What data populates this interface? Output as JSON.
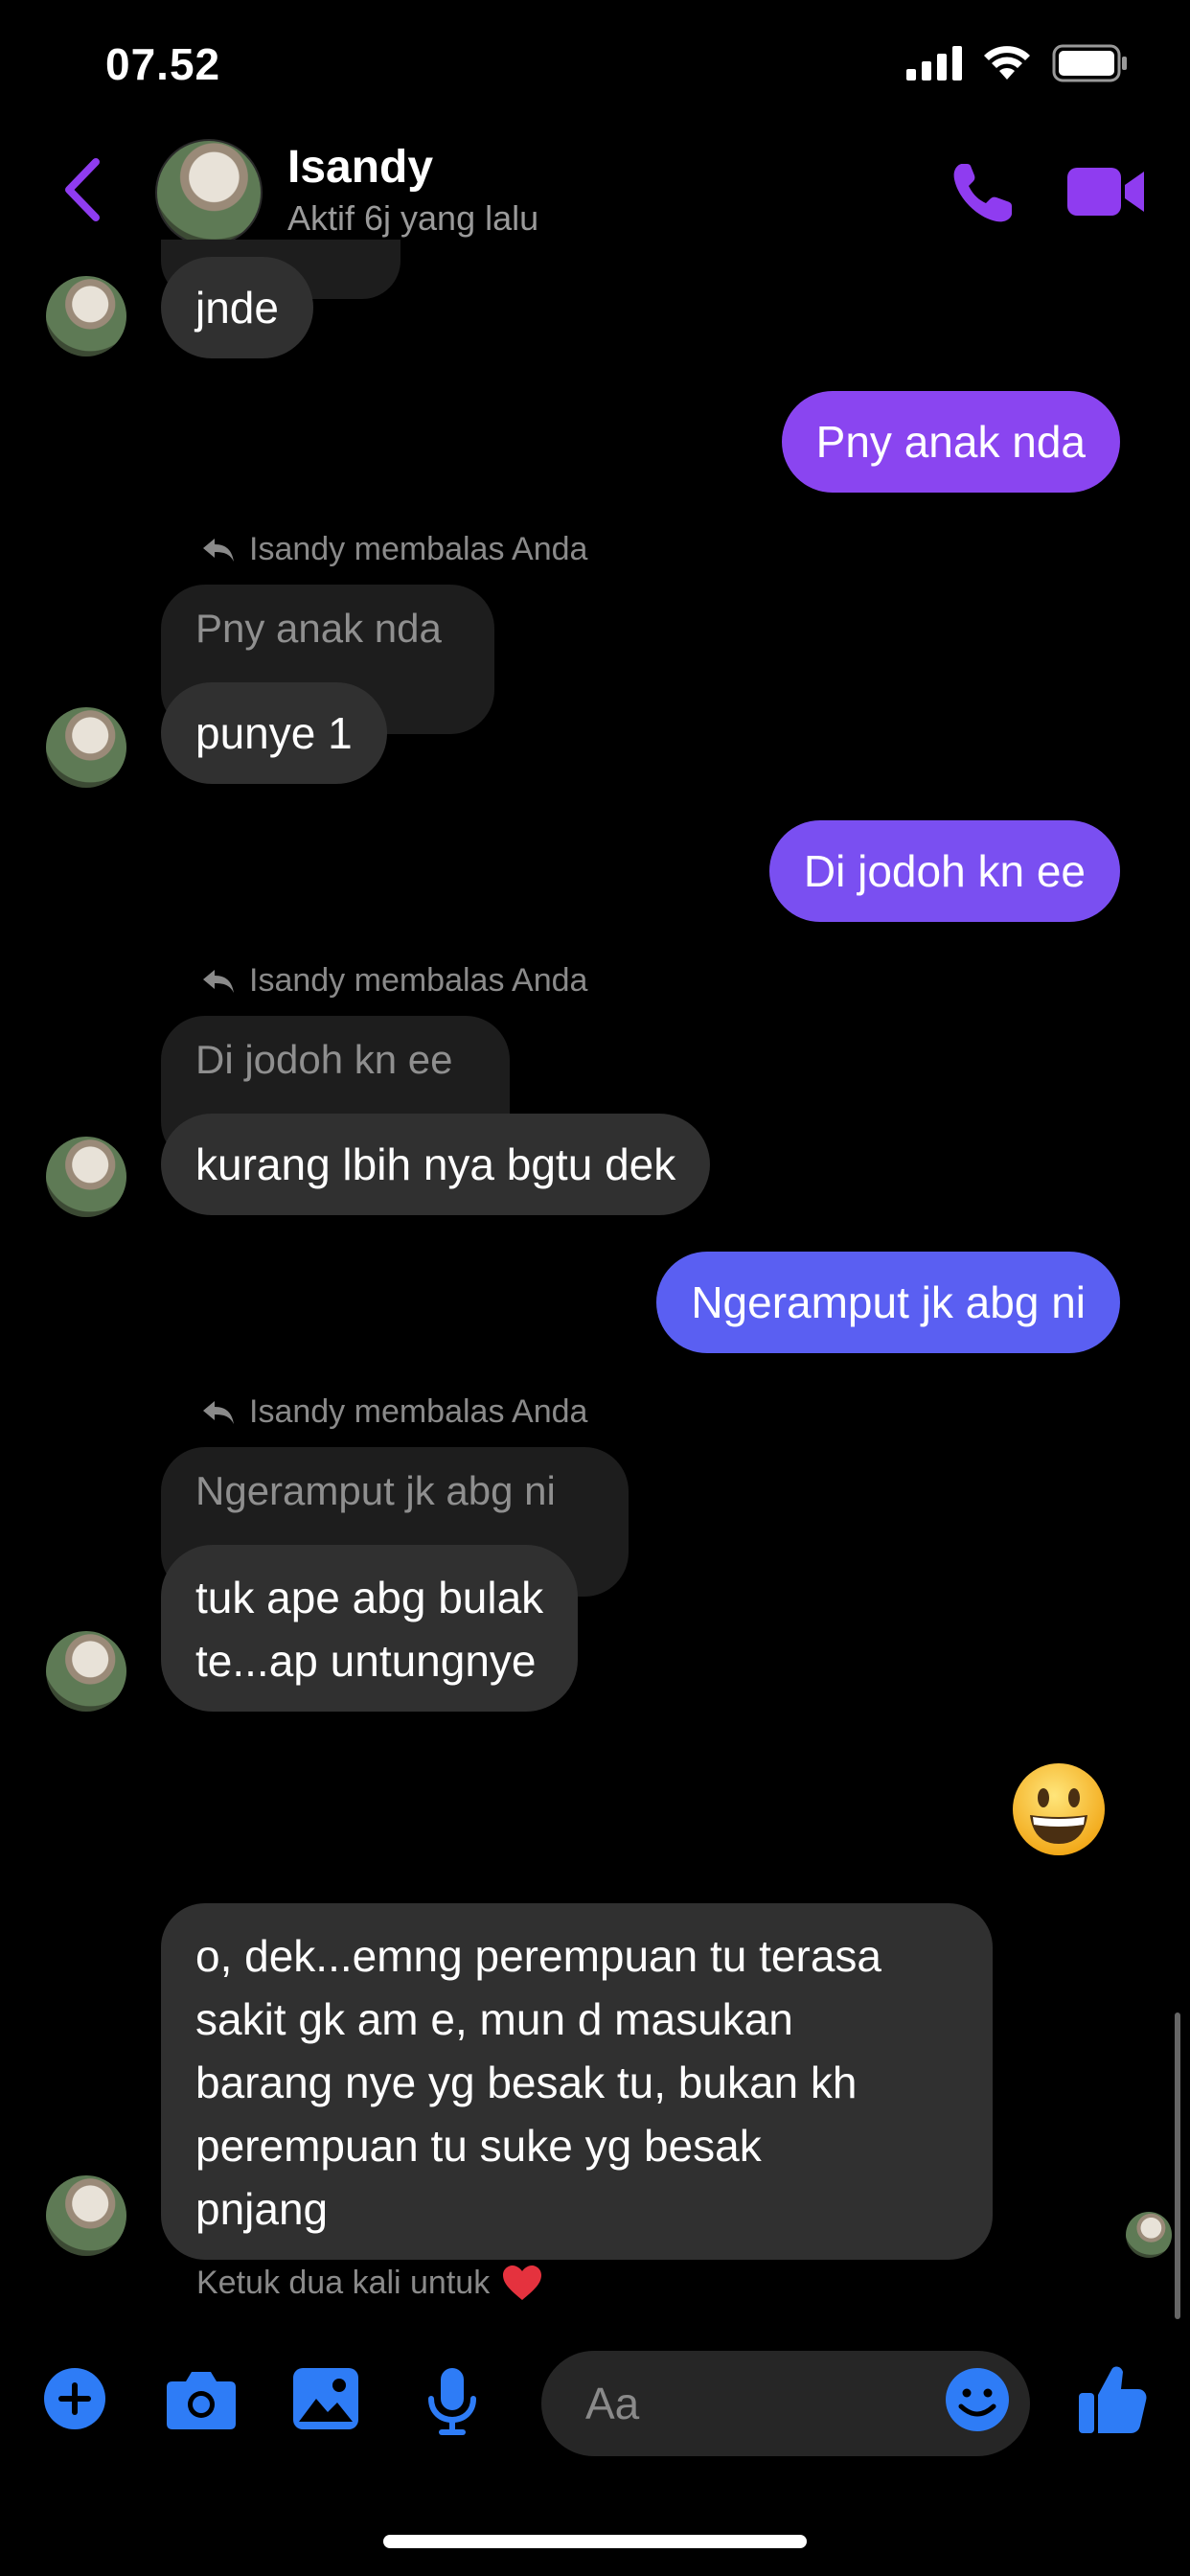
{
  "status_bar": {
    "time": "07.52"
  },
  "header": {
    "contact_name": "Isandy",
    "contact_status": "Aktif 6j yang lalu"
  },
  "messages": {
    "m1_text": "jnde",
    "m2_text": "Pny anak nda",
    "m3_reply_label": "Isandy membalas Anda",
    "m3_quote": "Pny anak nda",
    "m3_text": "punye 1",
    "m4_text": "Di jodoh kn ee",
    "m5_reply_label": "Isandy membalas Anda",
    "m5_quote": "Di jodoh kn ee",
    "m5_text": "kurang lbih nya bgtu dek",
    "m6_text": "Ngeramput jk abg ni",
    "m7_reply_label": "Isandy membalas Anda",
    "m7_quote": "Ngeramput jk abg ni",
    "m7_line1": "tuk ape abg bulak",
    "m7_line2": "te...ap untungnye",
    "m8_emoji": "grinning-face-emoji",
    "m9_line1": "o, dek...emng perempuan tu terasa",
    "m9_line2": "sakit gk am e, mun d masukan",
    "m9_line3": "barang nye yg besak tu, bukan kh",
    "m9_line4": "perempuan tu suke yg besak",
    "m9_line5": "pnjang"
  },
  "hint": {
    "text": "Ketuk dua kali untuk"
  },
  "composer": {
    "placeholder": "Aa"
  },
  "colors": {
    "accent": "#8f3cf0",
    "bubble_out_1": "#8a45f0",
    "bubble_out_2": "#6f55f2",
    "bubble_out_3": "#5a5ff2",
    "bubble_in": "#303030",
    "composer_blue": "#2e7cf6"
  }
}
